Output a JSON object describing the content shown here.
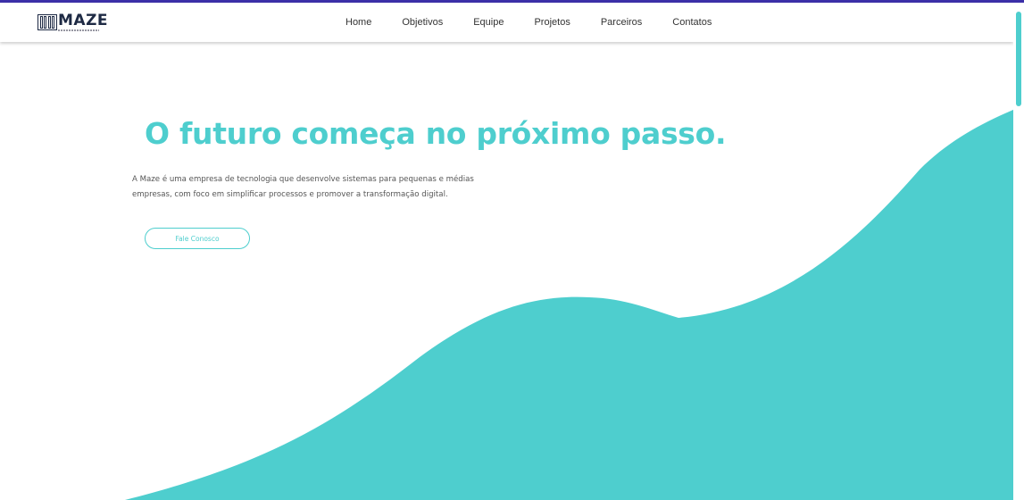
{
  "brand": {
    "name": "MAZE",
    "icon": "maze-logo-icon"
  },
  "nav": {
    "items": [
      {
        "label": "Home"
      },
      {
        "label": "Objetivos"
      },
      {
        "label": "Equipe"
      },
      {
        "label": "Projetos"
      },
      {
        "label": "Parceiros"
      },
      {
        "label": "Contatos"
      }
    ]
  },
  "hero": {
    "title": "O futuro começa no próximo passo.",
    "description": "A Maze é uma empresa de tecnologia que desenvolve sistemas para pequenas e médias empresas, com foco em simplificar processos e promover a transformação digital.",
    "cta_label": "Fale Conosco"
  },
  "colors": {
    "accent": "#4ecece",
    "brand_dark": "#1e2a44",
    "top_border": "#3c2fa8"
  }
}
